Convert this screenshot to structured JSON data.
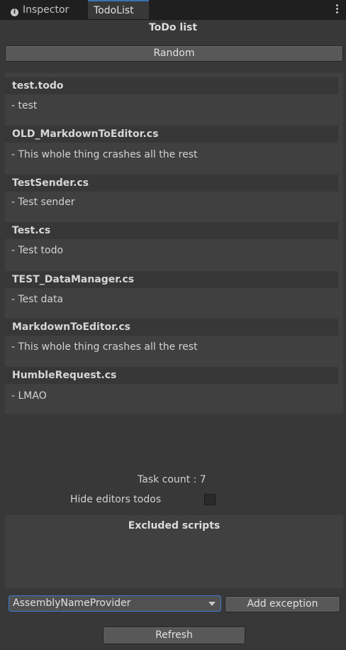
{
  "tabs": {
    "inspector_label": "Inspector",
    "todolist_label": "TodoList"
  },
  "title": "ToDo list",
  "random_button": "Random",
  "todos": [
    {
      "file": "test.todo",
      "text": "- test"
    },
    {
      "file": "OLD_MarkdownToEditor.cs",
      "text": "- This whole thing crashes all the rest"
    },
    {
      "file": "TestSender.cs",
      "text": "- Test sender"
    },
    {
      "file": "Test.cs",
      "text": "- Test todo"
    },
    {
      "file": "TEST_DataManager.cs",
      "text": "- Test data"
    },
    {
      "file": "MarkdownToEditor.cs",
      "text": "- This whole thing crashes all the rest"
    },
    {
      "file": "HumbleRequest.cs",
      "text": "- LMAO"
    }
  ],
  "task_count": "Task count : 7",
  "hide_editors_label": "Hide editors todos",
  "hide_editors_checked": false,
  "excluded_title": "Excluded scripts",
  "exception_dropdown": {
    "selected": "AssemblyNameProvider"
  },
  "add_exception_button": "Add exception",
  "refresh_button": "Refresh",
  "colors": {
    "accent": "#3b7ad1",
    "background": "#383838",
    "panel": "#404040"
  }
}
